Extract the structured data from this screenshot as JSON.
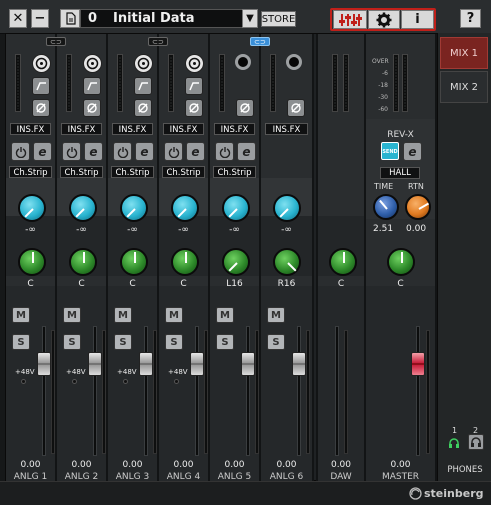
{
  "toolbar": {
    "close_label": "✕",
    "minimize_label": "−",
    "preset_number": "0",
    "preset_name": "Initial Data",
    "dropdown": "▼",
    "store_label": "STORE",
    "info_label": "i",
    "help_label": "?"
  },
  "strips": [
    {
      "label": "ANLG 1",
      "fx": "INS.FX",
      "chstrip": "Ch.Strip",
      "send": "-∞",
      "pan": "C",
      "fader": "0.00",
      "phantom": "+48V"
    },
    {
      "label": "ANLG 2",
      "fx": "INS.FX",
      "chstrip": "Ch.Strip",
      "send": "-∞",
      "pan": "C",
      "fader": "0.00",
      "phantom": "+48V"
    },
    {
      "label": "ANLG 3",
      "fx": "INS.FX",
      "chstrip": "Ch.Strip",
      "send": "-∞",
      "pan": "C",
      "fader": "0.00",
      "phantom": "+48V"
    },
    {
      "label": "ANLG 4",
      "fx": "INS.FX",
      "chstrip": "Ch.Strip",
      "send": "-∞",
      "pan": "C",
      "fader": "0.00",
      "phantom": "+48V"
    },
    {
      "label": "ANLG 5",
      "fx": "INS.FX",
      "chstrip": "Ch.Strip",
      "send": "-∞",
      "pan": "L16",
      "fader": "0.00"
    },
    {
      "label": "ANLG 6",
      "fx": "INS.FX",
      "chstrip": "Ch.Strip",
      "send": "-∞",
      "pan": "R16",
      "fader": "0.00"
    },
    {
      "label": "DAW",
      "pan": "C",
      "fader": "0.00"
    },
    {
      "label": "MASTER",
      "pan": "C",
      "fader": "0.00"
    }
  ],
  "reverb": {
    "title": "REV-X",
    "send_label": "SEND",
    "type": "HALL",
    "time_label": "TIME",
    "rtn_label": "RTN",
    "time_value": "2.51",
    "rtn_value": "0.00"
  },
  "master_scale": [
    "OVER",
    "-6",
    "-18",
    "-30",
    "-60"
  ],
  "ms": {
    "m": "M",
    "s": "S"
  },
  "mix_tabs": [
    "MIX 1",
    "MIX 2"
  ],
  "phones": {
    "label": "PHONES",
    "n1": "1",
    "n2": "2"
  },
  "brand": "steinberg",
  "colors": {
    "send_knob": "#29b4d0",
    "pan_knob": "#2e8a2a",
    "time_knob": "#2f5faa",
    "rtn_knob": "#e07a20",
    "master_cap": "#c8203c",
    "active_tab": "#7a2420",
    "link_active": "#3a8fd8"
  }
}
